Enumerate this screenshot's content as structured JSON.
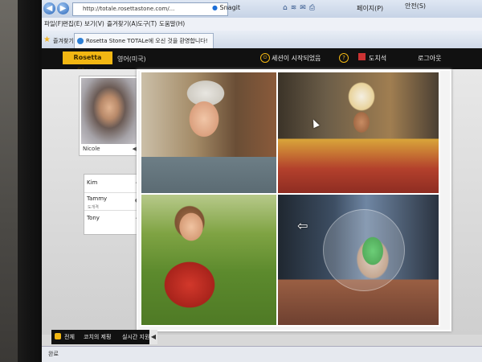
{
  "browser": {
    "url": "http://totale.rosettastone.com/...",
    "snagit": "Snagit",
    "menu": [
      "파일(F)",
      "편집(E)",
      "보기(V)",
      "즐겨찾기(A)",
      "도구(T)",
      "도움말(H)"
    ],
    "favorites_label": "즐겨찾기",
    "tab_title": "Rosetta Stone TOTALe에 오신 것을 환영합니다!",
    "page_menu": "페이지(P)",
    "safety_menu": "안전(S)"
  },
  "app": {
    "logo": "Rosetta Stone",
    "language": "영어(미국)",
    "session": "세션이 시작되었음",
    "help_icon": "?",
    "tutor": "도치석",
    "logout": "로그아웃"
  },
  "video": {
    "name": "Nicole"
  },
  "participants": [
    {
      "name": "Kim",
      "sub": ""
    },
    {
      "name": "Tammy",
      "sub": "도개격"
    },
    {
      "name": "Tony",
      "sub": ""
    }
  ],
  "bottom_bar": {
    "item1": "전체",
    "item2": "코치의 제핑",
    "item3": "실시간 지원"
  },
  "status": {
    "text": "완료"
  }
}
